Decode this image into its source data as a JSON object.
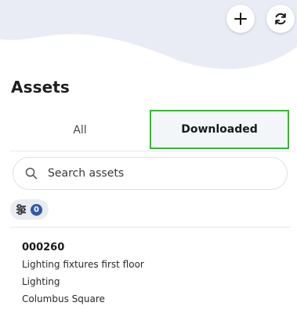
{
  "header": {
    "add_icon": "plus-icon",
    "refresh_icon": "refresh-icon",
    "wave_color": "#e9ecf5"
  },
  "page_title": "Assets",
  "tabs": [
    {
      "label": "All",
      "selected": false
    },
    {
      "label": "Downloaded",
      "selected": true
    }
  ],
  "search": {
    "placeholder": "Search assets",
    "value": ""
  },
  "filter": {
    "icon": "sliders-icon",
    "count": "0"
  },
  "assets": [
    {
      "id": "000260",
      "description": "Lighting fixtures first floor",
      "category": "Lighting",
      "location": "Columbus Square"
    }
  ],
  "colors": {
    "accent": "#2f5aa8",
    "highlight_border": "#22c51e",
    "selected_tab_bg": "#f3f6f9"
  }
}
